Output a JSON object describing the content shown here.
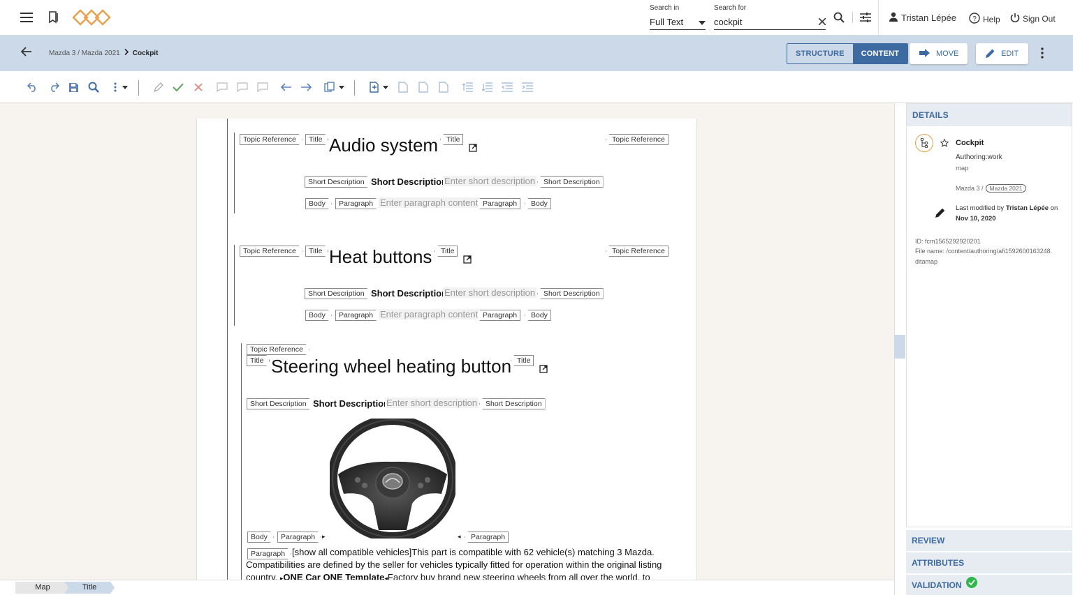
{
  "topbar": {
    "search_in_label": "Search in",
    "search_in_value": "Full Text",
    "search_for_label": "Search for",
    "search_for_value": "cockpit",
    "user_name": "Tristan Lépée",
    "help_label": "Help",
    "signout_label": "Sign Out"
  },
  "subbar": {
    "breadcrumb_path": "Mazda 3 / Mazda 2021",
    "breadcrumb_current": "Cockpit",
    "structure_label": "STRUCTURE",
    "content_label": "CONTENT",
    "move_label": "MOVE",
    "edit_label": "EDIT"
  },
  "editor": {
    "tags": {
      "topic_reference": "Topic Reference",
      "title": "Title",
      "short_description": "Short Description",
      "body": "Body",
      "paragraph": "Paragraph"
    },
    "short_description_label": "Short Description:",
    "short_description_placeholder": "Enter short description",
    "paragraph_placeholder": "Enter paragraph content",
    "topics": [
      {
        "title": "Audio system"
      },
      {
        "title": "Heat buttons"
      },
      {
        "title": "Steering wheel heating button"
      }
    ],
    "body_text": {
      "part1": "[show all compatible vehicles]This part is compatible with 62 vehicle(s) matching 3 Mazda. Compatibilities are defined by the seller for vehicles typically fitted for operation within the original listing country. ",
      "bold": "ONE Car ONE Template",
      "part2": "Factory buy brand new steering wheels from all over the world, to make"
    }
  },
  "details": {
    "header": "DETAILS",
    "name": "Cockpit",
    "workflow": "Authoring:work",
    "type": "map",
    "path_prefix": "Mazda 3 /",
    "path_chip": "Mazda 2021",
    "last_modified_prefix": "Last modified by",
    "last_modified_user": "Tristan Lépée",
    "last_modified_on": "on",
    "last_modified_date": "Nov 10, 2020",
    "id_line": "ID: fcm1565292920201",
    "file_line1": "File name: /content/authoring/afi1592600163248.",
    "file_line2": "ditamap"
  },
  "sections": {
    "review": "REVIEW",
    "attributes": "ATTRIBUTES",
    "validation": "VALIDATION"
  },
  "bottom": {
    "crumb1": "Map",
    "crumb2": "Title"
  },
  "colors": {
    "accent": "#3d6aa1",
    "subbar_bg": "#cbd9e8",
    "logo": "#e8a14a",
    "valid": "#2db84b"
  }
}
